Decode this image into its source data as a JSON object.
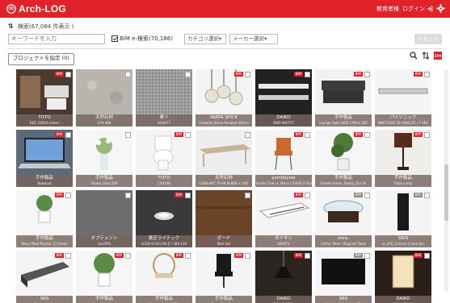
{
  "app": {
    "logo_text": "Arch-LOG"
  },
  "header": {
    "account_link": "教育者様",
    "login_label": "ログイン"
  },
  "search": {
    "title": "検索(",
    "count_note": "67,084",
    "title_suffix": " 件表示 )",
    "keyword_placeholder": "キーワードを入力",
    "bim_label": "BIM e-検索(70,186)",
    "category_dropdown": "カテゴリ選択▾",
    "maker_dropdown": "メーカー選択▾",
    "reset_label": "リセット"
  },
  "toolbar": {
    "project_button": "プロジェクトを指定 (0)"
  },
  "colors": {
    "brand": "#e0232b",
    "caption_bg": "#78645f"
  },
  "products": [
    {
      "name": "TOTO",
      "sub": "REO LUXUS Urban",
      "badge": "BIM"
    },
    {
      "name": "天然石材",
      "sub": "279-468",
      "badge": ""
    },
    {
      "name": "東リ",
      "sub": "GA4077",
      "badge": ""
    },
    {
      "name": "IWATA SPICE",
      "sub": "CaseLite Stone Pendant 50mm",
      "badge": "BIM"
    },
    {
      "name": "DAIKO",
      "sub": "DWP-4607YT",
      "badge": "BIM"
    },
    {
      "name": "手作製品",
      "sub": "Lounge Sofa 2000 CARLA 360",
      "badge": "BIM"
    },
    {
      "name": "パナソニック",
      "sub": "NNF21026 TK+NNLF45 / T ARS",
      "badge": "BIM"
    },
    {
      "name": "手作製品",
      "sub": "Notepad",
      "badge": "BIM"
    },
    {
      "name": "手作製品",
      "sub": "Flower Vase 500",
      "badge": ""
    },
    {
      "name": "TOTO",
      "sub": "CS810B",
      "badge": "BIM"
    },
    {
      "name": "天然石材",
      "sub": "LOWLANT TA-08 W 800 × 200",
      "badge": ""
    },
    {
      "name": "ysmiblyow",
      "sub": "Inside Chair 4, Black (70/E8) 4 Sticks",
      "badge": "BIM"
    },
    {
      "name": "手作製品",
      "sub": "Schefa Green_Stably_Gla 3X",
      "badge": "BIM"
    },
    {
      "name": "手作製品",
      "sub": "Table Lamp",
      "badge": "BIM"
    },
    {
      "name": "手作製品",
      "sub": "Waxy Plant Planter 13 Green",
      "badge": "BIM"
    },
    {
      "name": "オプテュソン",
      "sub": "5ec/FP4",
      "badge": ""
    },
    {
      "name": "東芝ライテック",
      "sub": "LEDD-87023 NS JF / WH-LS9",
      "badge": "BIM"
    },
    {
      "name": "ボード",
      "sub": "Wall Veil",
      "badge": ""
    },
    {
      "name": "ダイキン",
      "sub": "S40RTV",
      "badge": "BIM"
    },
    {
      "name": "vitra.",
      "sub": "Coffee Table / Noguchi Table",
      "badge": "BIM"
    },
    {
      "name": "SRIS",
      "sub": "ut_450_Column Crane Bar",
      "badge": "BIM"
    },
    {
      "name": "SRS",
      "sub": "Bench / Bolt",
      "badge": "BIM"
    },
    {
      "name": "手作製品",
      "sub": "Hanging Plant",
      "badge": "BIM"
    },
    {
      "name": "手作製品",
      "sub": "Rattan Chair 3000",
      "badge": "BIM"
    },
    {
      "name": "手作製品",
      "sub": "Executive Chair",
      "badge": "BIM"
    },
    {
      "name": "DAIKO",
      "sub": "DPN-41059Y",
      "badge": "BIM"
    },
    {
      "name": "SRS",
      "sub": "Schwarz Wall Lines TV",
      "badge": "BIM"
    },
    {
      "name": "DAIKO",
      "sub": "DFS-48024Y",
      "badge": "BIM"
    }
  ]
}
